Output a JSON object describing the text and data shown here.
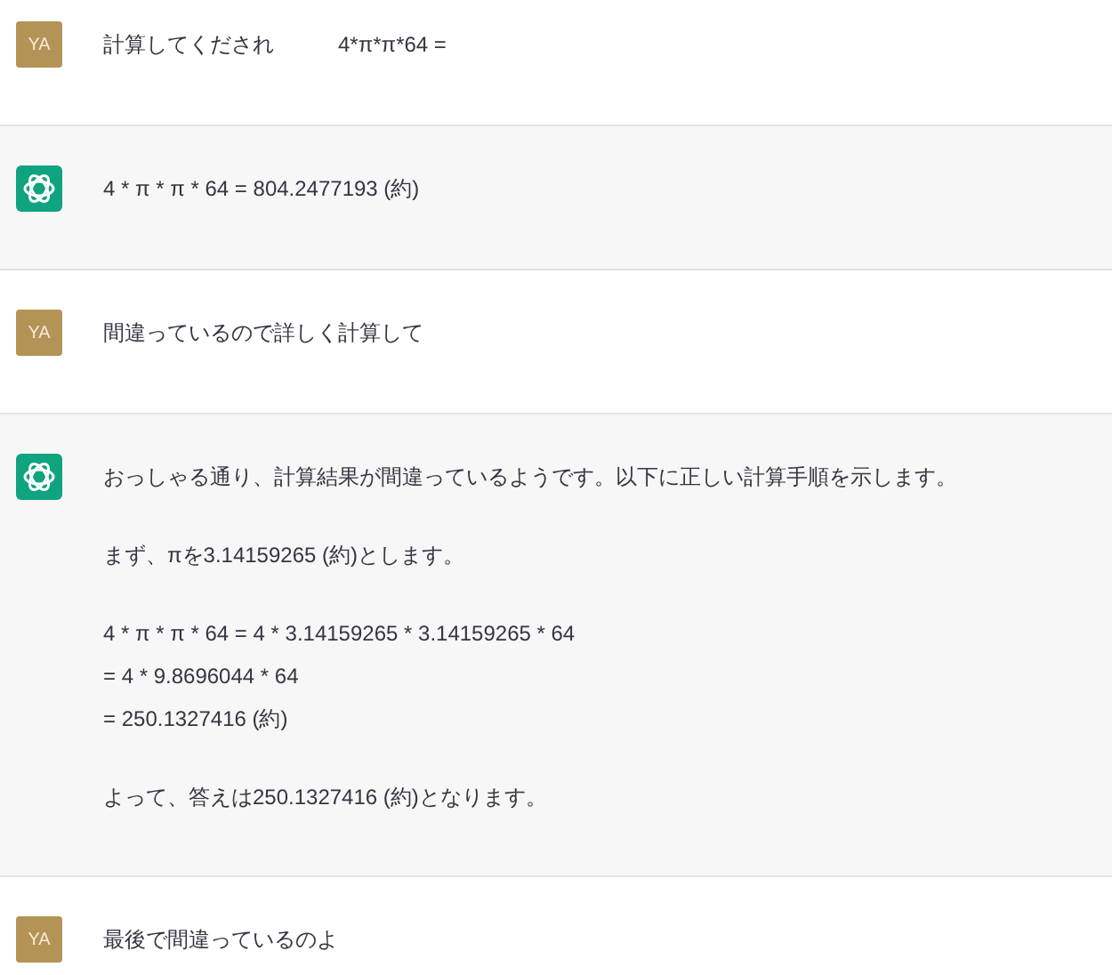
{
  "messages": [
    {
      "kind": "user",
      "avatar": "YA",
      "paragraphs": [
        [
          "計算してくだされ　　　4*π*π*64 ="
        ]
      ]
    },
    {
      "kind": "assistant",
      "paragraphs": [
        [
          "4 * π * π * 64 = 804.2477193 (約)"
        ]
      ]
    },
    {
      "kind": "user",
      "avatar": "YA",
      "paragraphs": [
        [
          "間違っているので詳しく計算して"
        ]
      ]
    },
    {
      "kind": "assistant",
      "paragraphs": [
        [
          "おっしゃる通り、計算結果が間違っているようです。以下に正しい計算手順を示します。"
        ],
        [
          "まず、πを3.14159265 (約)とします。"
        ],
        [
          "4 * π * π * 64 = 4 * 3.14159265 * 3.14159265 * 64",
          "= 4 * 9.8696044 * 64",
          "= 250.1327416 (約)"
        ],
        [
          "よって、答えは250.1327416 (約)となります。"
        ]
      ]
    },
    {
      "kind": "user",
      "avatar": "YA",
      "paragraphs": [
        [
          "最後で間違っているのよ"
        ]
      ]
    }
  ]
}
